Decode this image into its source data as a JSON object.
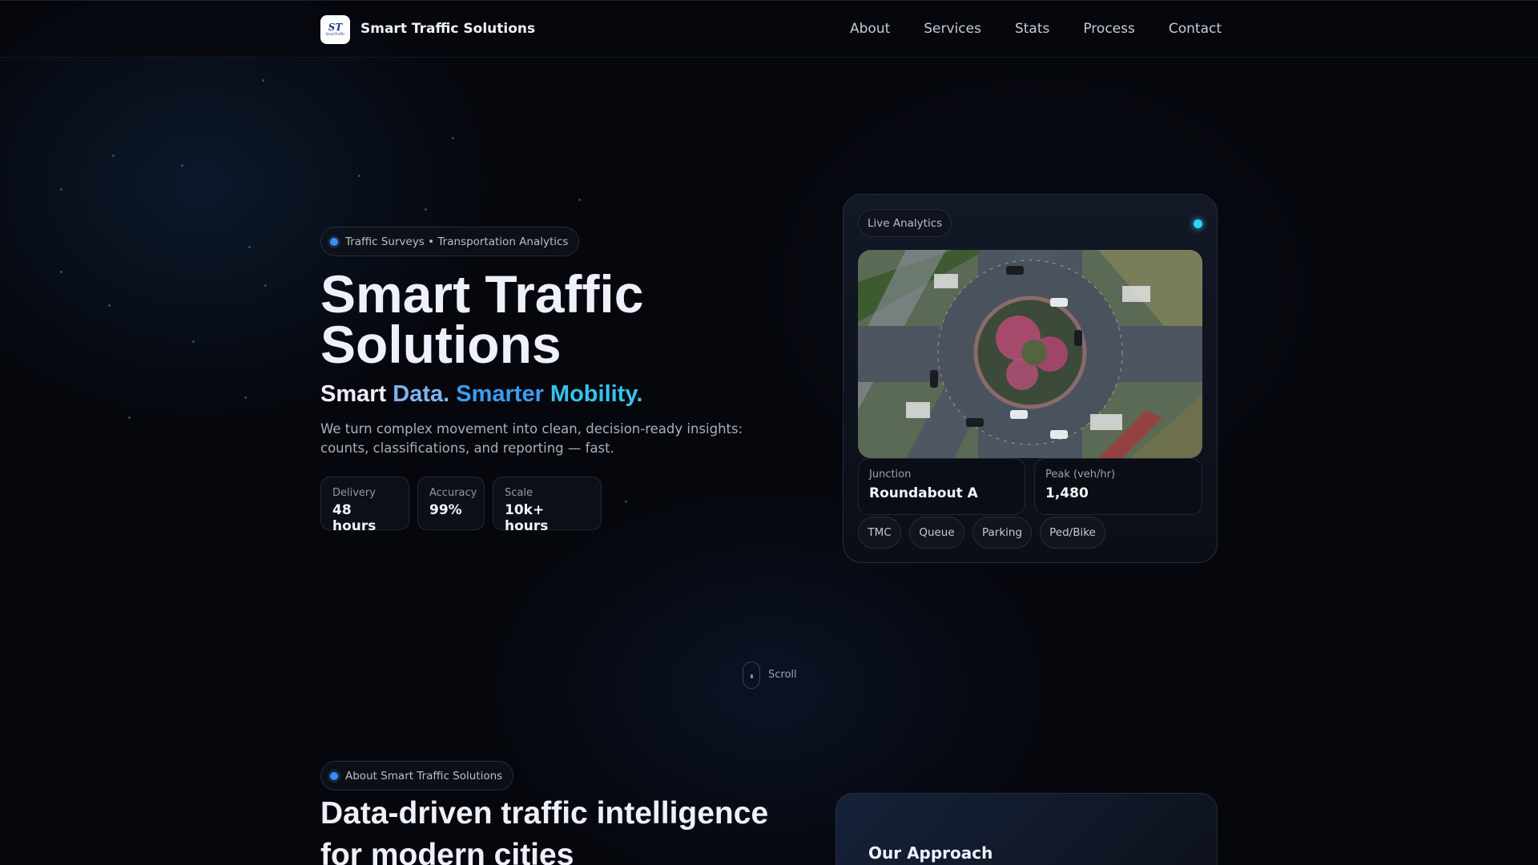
{
  "nav": {
    "brand": "Smart Traffic Solutions",
    "logo_text": "ST",
    "logo_sub": "SmartTraffic",
    "links": [
      "About",
      "Services",
      "Stats",
      "Process",
      "Contact"
    ]
  },
  "hero": {
    "badge": "Traffic Surveys • Transportation Analytics",
    "title_line1": "Smart Traffic",
    "title_line2": "Solutions",
    "tagline": {
      "p1": "Smart ",
      "p2": "Data. ",
      "p3": "Smarter ",
      "p4": "Mobility."
    },
    "lead": "We turn complex movement into clean, decision-ready insights: counts, classifications, and reporting — fast.",
    "stats": [
      {
        "label": "Delivery",
        "value": "48 hours"
      },
      {
        "label": "Accuracy",
        "value": "99%"
      },
      {
        "label": "Scale",
        "value": "10k+ hours"
      }
    ]
  },
  "card": {
    "badge": "Live Analytics",
    "status_color": "#2fd3f5",
    "junction_label": "Junction",
    "junction_value": "Roundabout A",
    "peak_label": "Peak (veh/hr)",
    "peak_value": "1,480",
    "chips": [
      "TMC",
      "Queue",
      "Parking",
      "Ped/Bike"
    ]
  },
  "scroll": "Scroll",
  "about": {
    "badge": "About Smart Traffic Solutions",
    "heading": "Data-driven traffic intelligence for modern cities",
    "approach_title": "Our Approach"
  }
}
